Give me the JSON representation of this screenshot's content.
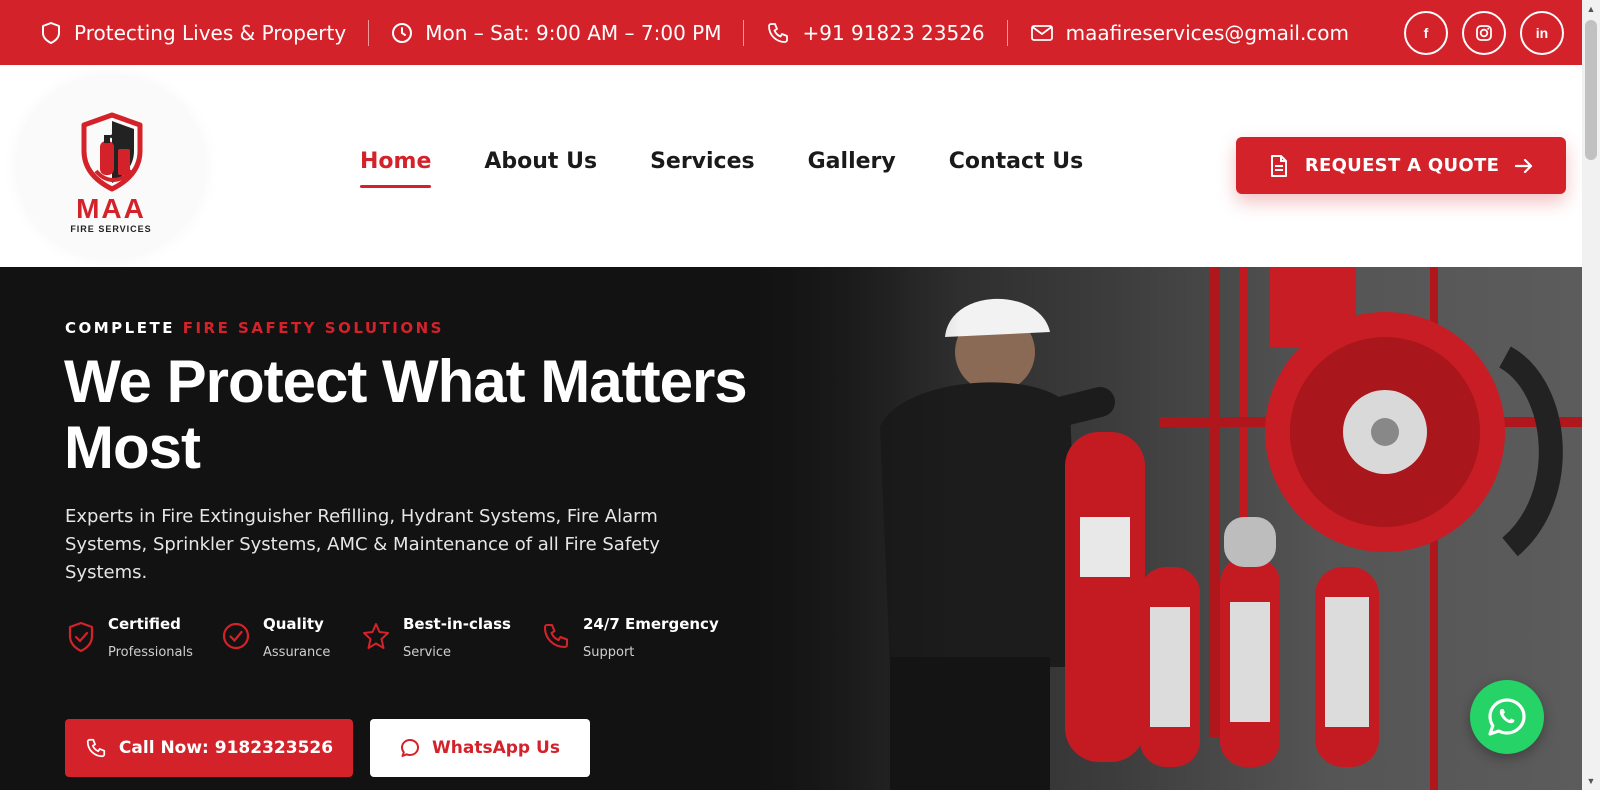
{
  "topbar": {
    "tagline": "Protecting Lives & Property",
    "hours": "Mon – Sat: 9:00 AM – 7:00 PM",
    "phone": "+91 91823 23526",
    "email": "maafireservices@gmail.com",
    "socials": [
      {
        "label": "f",
        "icon": "facebook-icon"
      },
      {
        "label": "◎",
        "icon": "instagram-icon"
      },
      {
        "label": "in",
        "icon": "linkedin-icon"
      }
    ]
  },
  "header": {
    "logo": {
      "name": "MAA",
      "subtitle": "FIRE SERVICES"
    },
    "nav": [
      {
        "label": "Home",
        "active": true
      },
      {
        "label": "About Us"
      },
      {
        "label": "Services"
      },
      {
        "label": "Gallery"
      },
      {
        "label": "Contact Us"
      }
    ],
    "quote_button": "REQUEST A QUOTE"
  },
  "hero": {
    "eyebrow_prefix": "COMPLETE",
    "eyebrow_highlight": "FIRE SAFETY SOLUTIONS",
    "title": "We Protect What Matters Most",
    "description": "Experts in Fire Extinguisher Refilling, Hydrant Systems, Fire Alarm Systems, Sprinkler Systems, AMC & Maintenance of all Fire Safety Systems.",
    "features": [
      {
        "title": "Certified",
        "subtitle": "Professionals",
        "icon": "shield-check-icon"
      },
      {
        "title": "Quality",
        "subtitle": "Assurance",
        "icon": "check-circle-icon"
      },
      {
        "title": "Best-in-class",
        "subtitle": "Service",
        "icon": "star-icon"
      },
      {
        "title": "24/7 Emergency",
        "subtitle": "Support",
        "icon": "phone-icon"
      }
    ],
    "call_button": "Call Now: 9182323526",
    "whatsapp_button": "WhatsApp Us"
  },
  "colors": {
    "brand_red": "#d4222a",
    "whatsapp_green": "#25d366",
    "hero_bg": "#121212"
  }
}
